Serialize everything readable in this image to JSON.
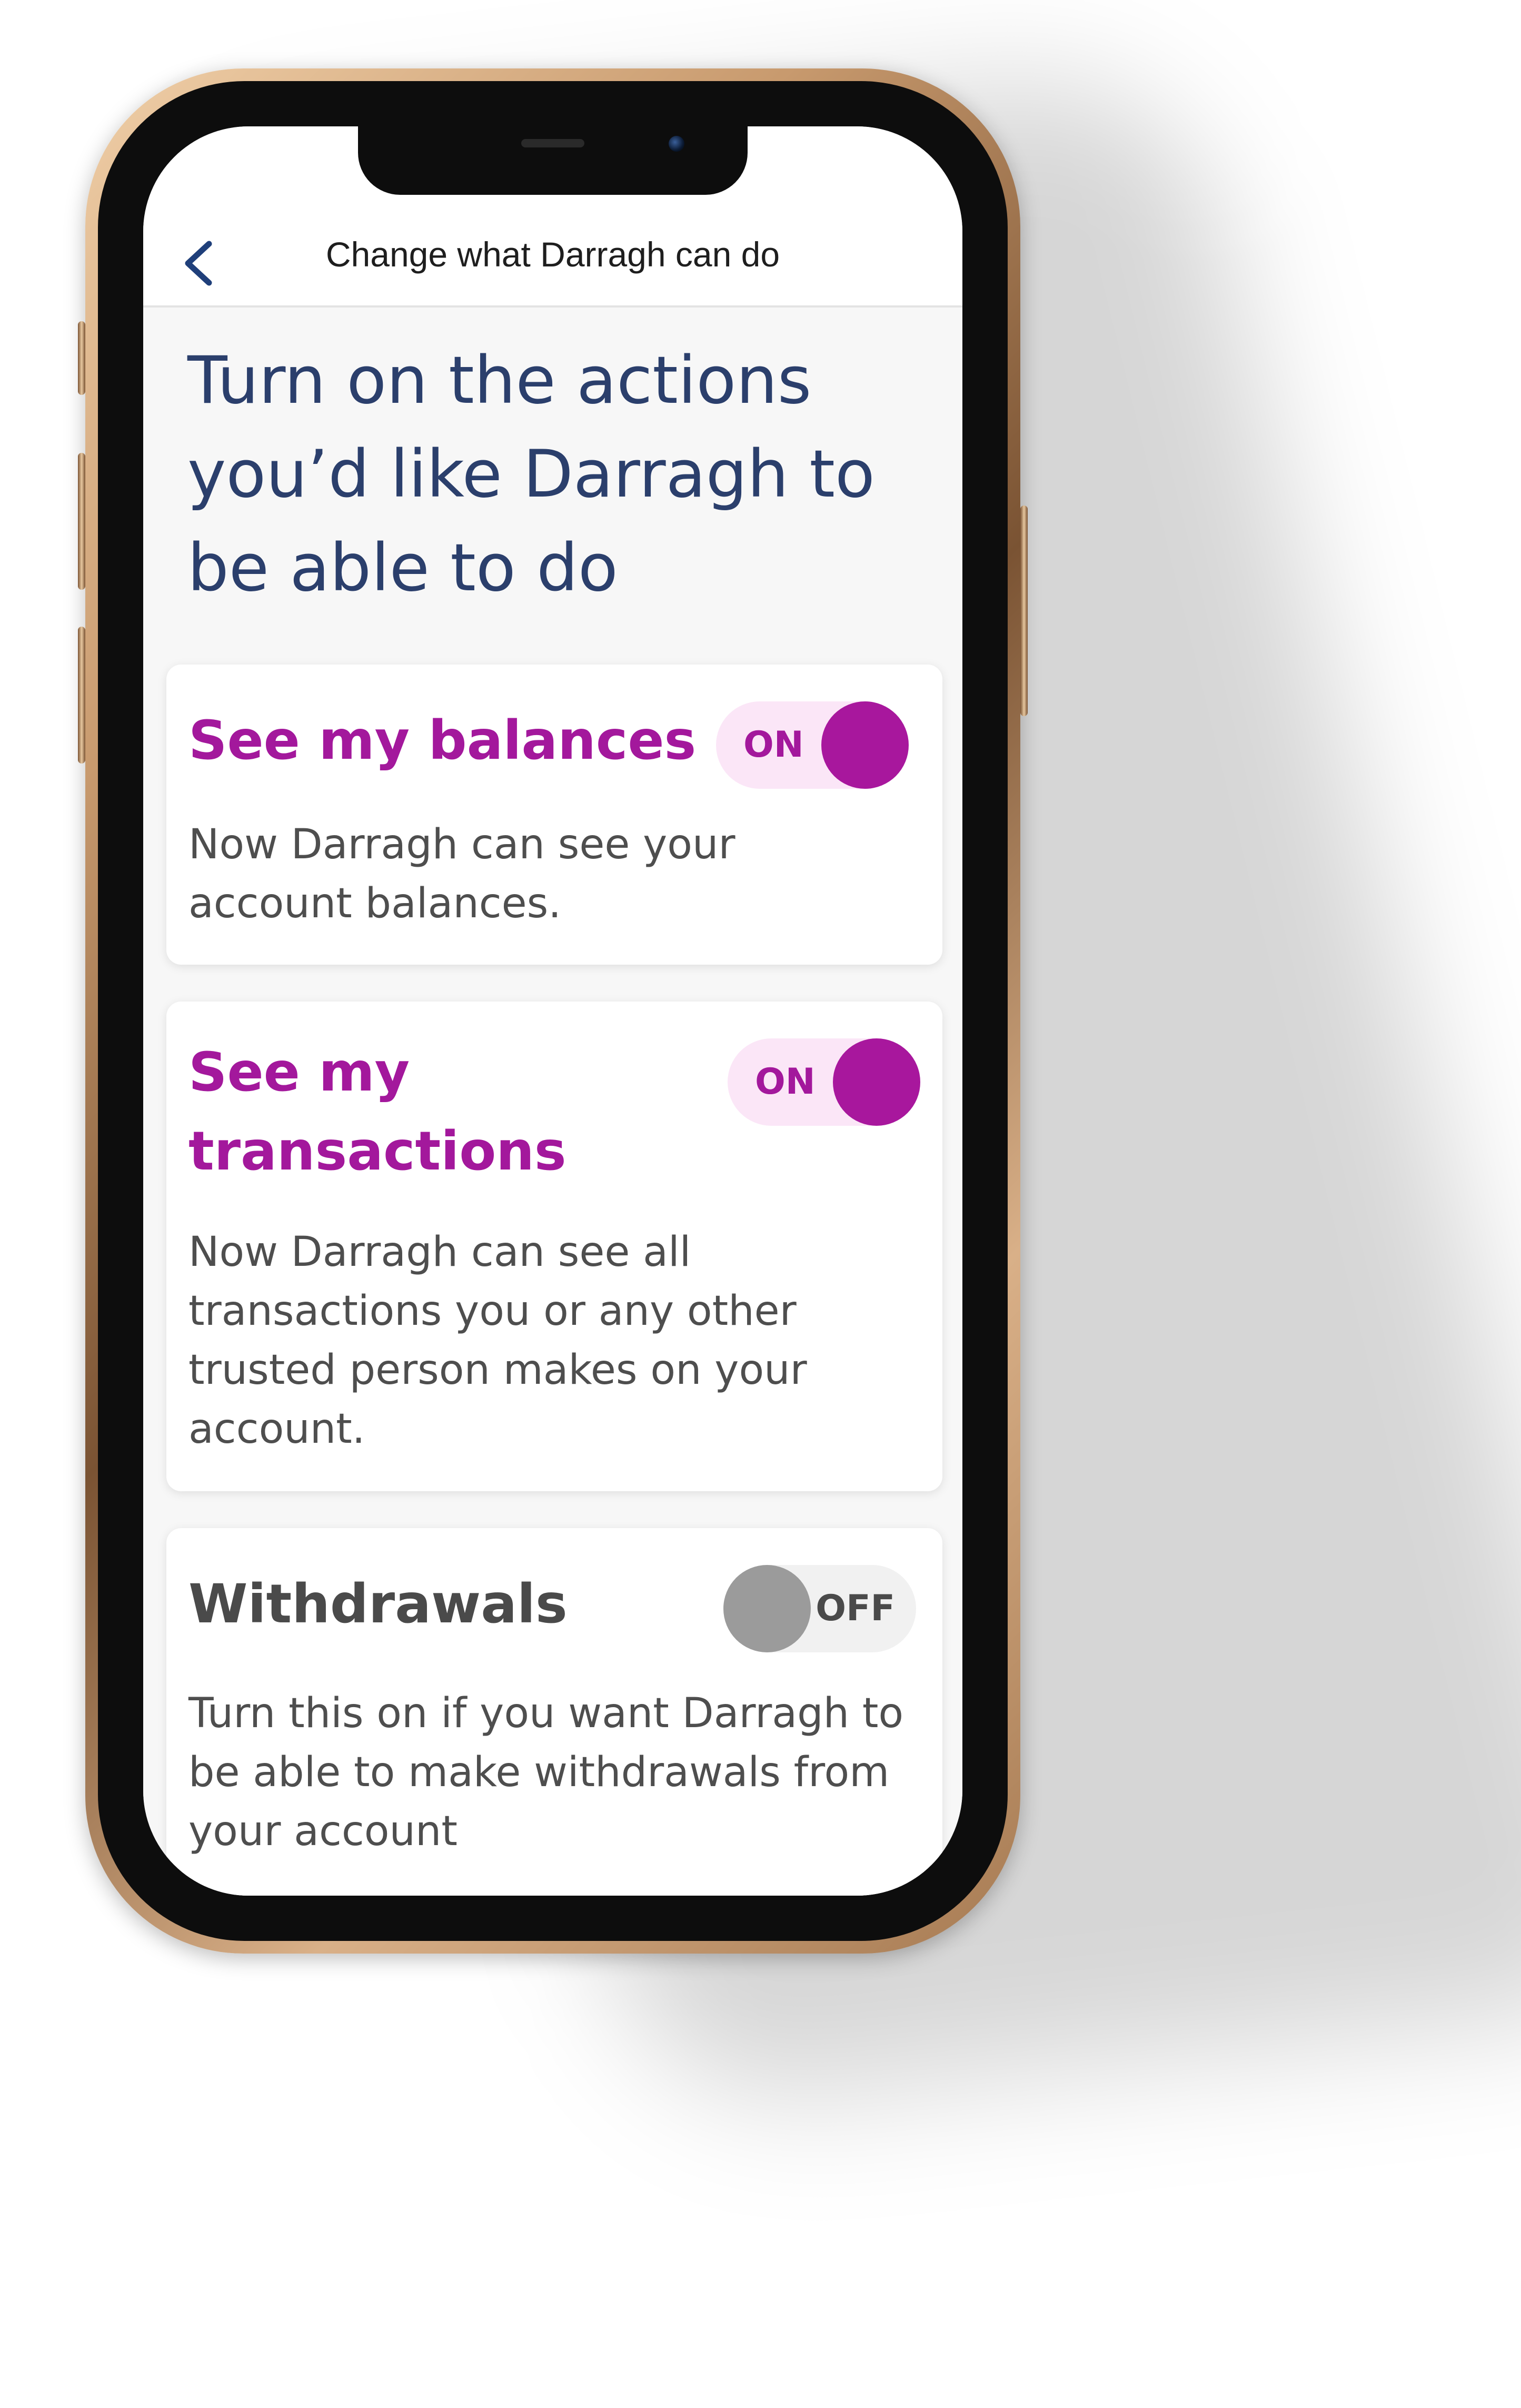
{
  "nav": {
    "title": "Change what Darragh can do",
    "back_icon": "chevron-left-icon"
  },
  "heading": "Turn on the actions you’d like Darragh to be able to do",
  "colors": {
    "heading": "#2b3f6c",
    "accent": "#a3189c",
    "toggle_on_bg": "#fbe6f7",
    "toggle_off_knob": "#9b9b9b",
    "body_text": "#4e4e4e"
  },
  "permissions": [
    {
      "title": "See my balances",
      "toggle_label": "ON",
      "enabled": true,
      "description": "Now Darragh can see your account balances."
    },
    {
      "title": "See my transactions",
      "toggle_label": "ON",
      "enabled": true,
      "description": "Now Darragh can see all transactions you or any other trusted person makes on your account."
    },
    {
      "title": "Withdrawals",
      "toggle_label": "OFF",
      "enabled": false,
      "description": "Turn this on if you want Darragh to be able to make withdrawals from your account"
    }
  ]
}
